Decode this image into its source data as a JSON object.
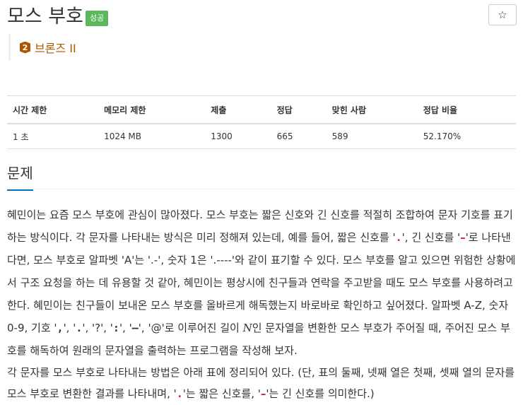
{
  "problem": {
    "title": "모스 부호",
    "status_badge": "성공",
    "star_label": "☆",
    "tier": {
      "number": "2",
      "name": "브론즈 II",
      "color": "#ad5600"
    }
  },
  "stats": {
    "headers": [
      "시간 제한",
      "메모리 제한",
      "제출",
      "정답",
      "맞힌 사람",
      "정답 비율"
    ],
    "values": [
      "1 초",
      "1024 MB",
      "1300",
      "665",
      "589",
      "52.170%"
    ]
  },
  "section": {
    "title": "문제"
  },
  "description": {
    "p1": {
      "s1": "혜민이는 요즘 모스 부호에 관심이 많아졌다. 모스 부호는 짧은 신호와 긴 신호를 적절히 조합하여 문자 기호를 표기하는 방식이다. 각 문자를 나타내는 방식은 미리 정해져 있는데, 예를 들어, 짧은 신호를 '",
      "dot": ".",
      "s2": "', 긴 신호를 '",
      "dash": "–",
      "s3": "'로 나타낸다면, 모스 부호로 알파벳 'A'는 '.-', 숫자 1은 '.----'와 같이 표기할 수 있다. 모스 부호를 알고 있으면 위험한 상황에서 구조 요청을 하는 데 유용할 것 같아, 혜민이는 평상시에 친구들과 연락을 주고받을 때도 모스 부호를 사용하려고 한다. 혜민이는 친구들이 보내온 모스 부호를 올바르게 해독했는지 바로바로 확인하고 싶어졌다. 알파벳 A-Z, 숫자 0-9, 기호 '",
      "sym1": ",",
      "sym1_sep": "', '",
      "sym2": ".",
      "sym2_sep": "', '?', '",
      "sym3": ":",
      "sym3_sep": "', '",
      "sym4": "–",
      "s4": "', '@'로 이루어진 길이 ",
      "var_n": "N",
      "s5": "인 문자열을 변환한 모스 부호가 주어질 때, 주어진 모스 부호를 해독하여 원래의 문자열을 출력하는 프로그램을 작성해 보자."
    },
    "p2": {
      "s1": "각 문자를 모스 부호로 나타내는 방법은 아래 표에 정리되어 있다. (단, 표의 둘째, 넷째 열은 첫째, 셋째 열의 문자를 모스 부호로 변환한 결과를 나타내며, '",
      "dot": ".",
      "s2": "'는 짧은 신호를, '",
      "dash": "–",
      "s3": "'는 긴 신호를 의미한다.)"
    }
  }
}
